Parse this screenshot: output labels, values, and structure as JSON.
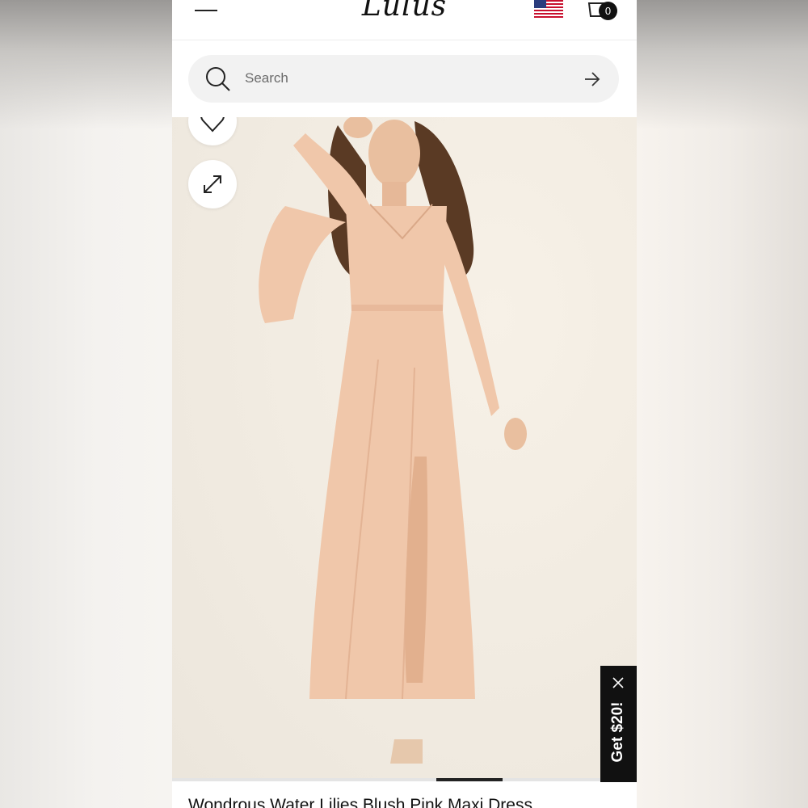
{
  "header": {
    "brand": "Lulus",
    "cart_count": "0"
  },
  "search": {
    "placeholder": "Search"
  },
  "product": {
    "title": "Wondrous Water Lilies Blush Pink Maxi Dress"
  },
  "promo": {
    "label": "Get $20!"
  },
  "icons": [
    "menu-icon",
    "flag-icon",
    "cart-icon",
    "search-icon",
    "arrow-right-icon",
    "heart-icon",
    "expand-icon",
    "close-icon"
  ],
  "colors": {
    "dress": "#f0c7aa",
    "promo_bg": "#111111",
    "search_bg": "#f2f2f2"
  }
}
